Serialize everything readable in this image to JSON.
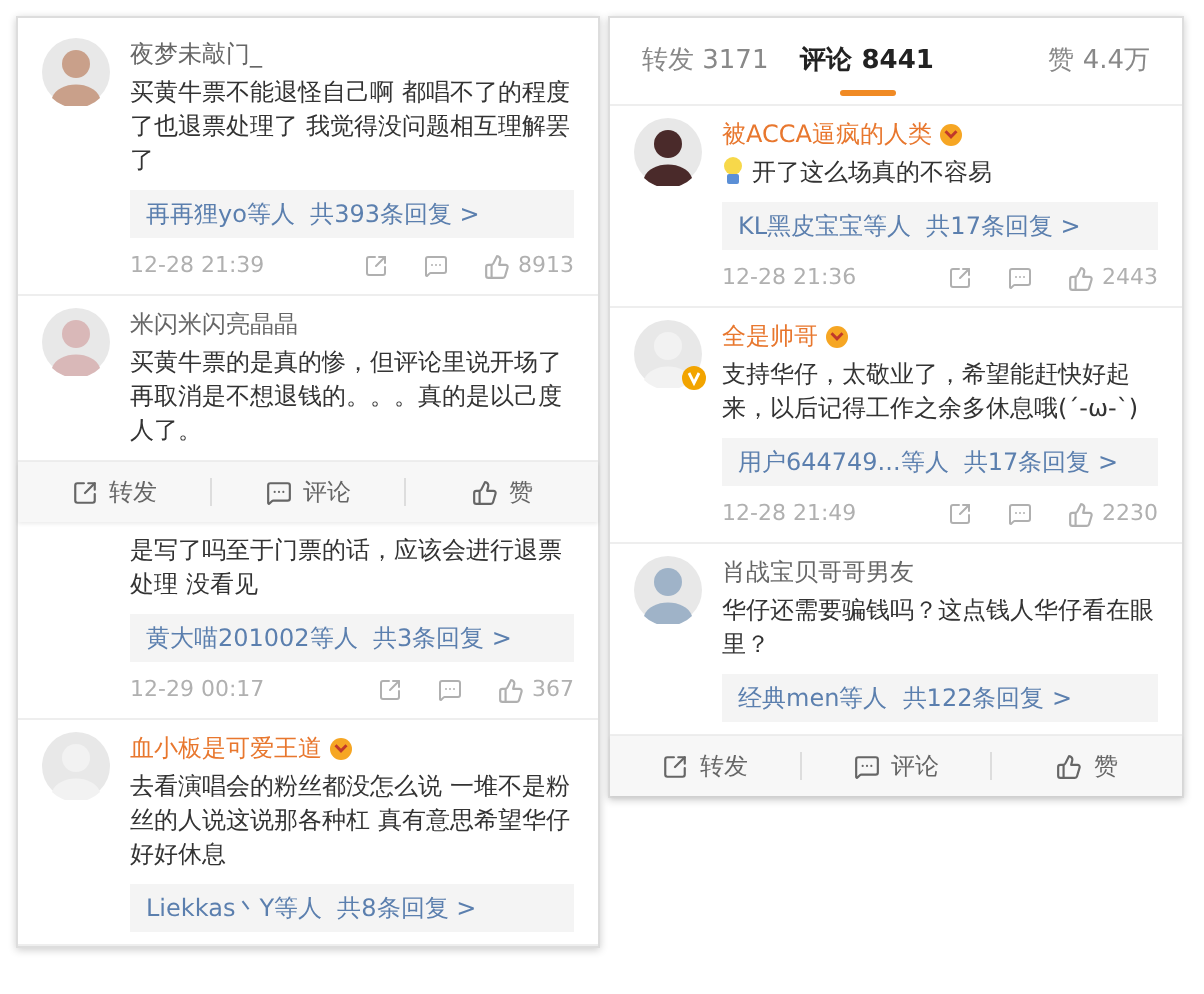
{
  "left_screenshot": {
    "items": [
      {
        "kind": "comment",
        "name": "夜梦未敲门_",
        "vip": false,
        "verified": false,
        "has_emoji": false,
        "text": "买黄牛票不能退怪自己啊 都唱不了的程度了也退票处理了 我觉得没问题相互理解罢了",
        "replies": "再再狸yo等人  共393条回复 >",
        "date": "12-28 21:39",
        "likes": "8913"
      },
      {
        "kind": "comment",
        "name": "米闪米闪亮晶晶",
        "vip": false,
        "verified": false,
        "has_emoji": false,
        "text": "买黄牛票的是真的惨，但评论里说开场了再取消是不想退钱的。。。真的是以己度人了。"
      },
      {
        "kind": "action_bar",
        "buttons": [
          {
            "kind": "share",
            "label": "转发"
          },
          {
            "kind": "comment",
            "label": "评论"
          },
          {
            "kind": "like",
            "label": "赞"
          }
        ]
      },
      {
        "kind": "fragment",
        "text": "是写了吗至于门票的话，应该会进行退票处理 没看见",
        "replies": "黄大喵201002等人  共3条回复 >",
        "date": "12-29 00:17",
        "likes": "367"
      },
      {
        "kind": "comment",
        "name": "血小板是可爱王道",
        "vip": true,
        "verified": false,
        "has_emoji": false,
        "text": "去看演唱会的粉丝都没怎么说 一堆不是粉丝的人说这说那各种杠 真有意思希望华仔好好休息",
        "replies": "Liekkas丶Y等人  共8条回复 >"
      }
    ]
  },
  "right_screenshot": {
    "tabs": [
      {
        "label": "转发 3171",
        "selected": false
      },
      {
        "label": "评论 8441",
        "selected": true
      },
      {
        "label": "赞 4.4万",
        "selected": false
      }
    ],
    "items": [
      {
        "kind": "comment",
        "name": "被ACCA逼疯的人类",
        "vip": true,
        "verified": false,
        "has_emoji": true,
        "text": "开了这么场真的不容易",
        "replies": "KL黑皮宝宝等人  共17条回复 >",
        "date": "12-28 21:36",
        "likes": "2443"
      },
      {
        "kind": "comment",
        "name": "全是帅哥",
        "vip": true,
        "verified": true,
        "has_emoji": false,
        "text": "支持华仔，太敬业了，希望能赶快好起来，以后记得工作之余多休息哦(´-ω-`)",
        "replies": "用户644749...等人  共17条回复 >",
        "date": "12-28 21:49",
        "likes": "2230"
      },
      {
        "kind": "comment",
        "name": "肖战宝贝哥哥男友",
        "vip": false,
        "verified": false,
        "has_emoji": false,
        "text": "华仔还需要骗钱吗？这点钱人华仔看在眼里？",
        "replies": "经典men等人  共122条回复 >"
      },
      {
        "kind": "action_bar",
        "buttons": [
          {
            "kind": "share",
            "label": "转发"
          },
          {
            "kind": "comment",
            "label": "评论"
          },
          {
            "kind": "like",
            "label": "赞"
          }
        ]
      }
    ]
  }
}
